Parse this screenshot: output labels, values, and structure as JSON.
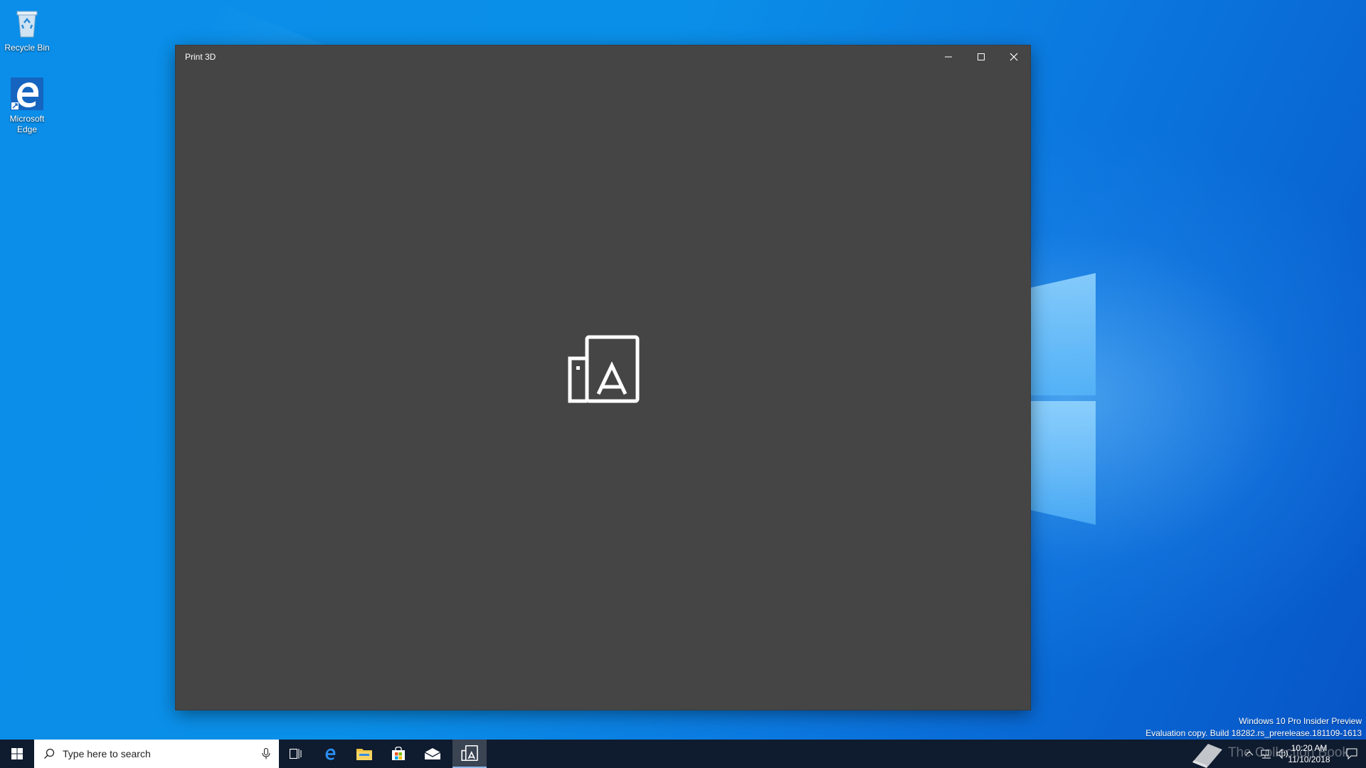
{
  "desktop": {
    "icons": [
      {
        "label": "Recycle Bin",
        "icon": "recycle-bin-icon"
      },
      {
        "label": "Microsoft Edge",
        "icon": "edge-icon"
      }
    ]
  },
  "window": {
    "title": "Print 3D",
    "controls": {
      "minimize": "minimize-icon",
      "maximize": "maximize-icon",
      "close": "close-icon"
    },
    "background_color": "#454545",
    "splash_icon": "print-3d-icon"
  },
  "watermark": {
    "line1": "Windows 10 Pro Insider Preview",
    "line2": "Evaluation copy. Build 18282.rs_prerelease.181109-1613"
  },
  "taskbar": {
    "search_placeholder": "Type here to search",
    "pinned": [
      {
        "name": "task-view",
        "icon": "task-view-icon"
      },
      {
        "name": "edge",
        "icon": "edge-icon"
      },
      {
        "name": "file-explorer",
        "icon": "folder-icon"
      },
      {
        "name": "store",
        "icon": "store-icon"
      },
      {
        "name": "mail",
        "icon": "mail-icon"
      },
      {
        "name": "print-3d",
        "icon": "print-3d-icon",
        "active": true
      }
    ],
    "tray": {
      "overlay_text": "The Collection Book",
      "time": "10:20 AM",
      "date": "11/10/2018"
    },
    "accent_color": "#0f1b2e"
  }
}
